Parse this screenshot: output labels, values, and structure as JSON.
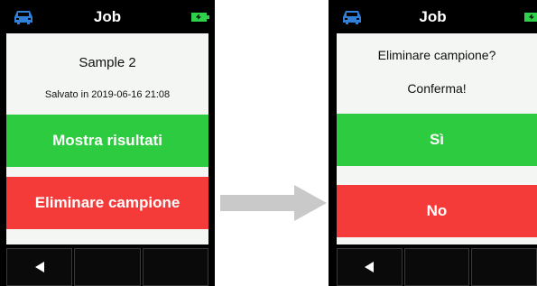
{
  "left_screen": {
    "title": "Job",
    "sample_name": "Sample 2",
    "saved_text": "Salvato in 2019-06-16 21:08",
    "show_results_label": "Mostra risultati",
    "delete_sample_label": "Eliminare campione"
  },
  "right_screen": {
    "title": "Job",
    "question": "Eliminare campione?",
    "confirm_text": "Conferma!",
    "yes_label": "Sì",
    "no_label": "No"
  },
  "icons": {
    "status_left": "car-icon",
    "status_right": "battery-icon",
    "nav_back": "back-arrow-icon",
    "transition": "right-arrow-icon"
  },
  "colors": {
    "accent_blue": "#2f7fd6",
    "battery_green": "#2fd14a",
    "confirm_green": "#2dcb3f",
    "danger_red": "#f53a3a",
    "arrow_gray": "#c9c9c9"
  }
}
